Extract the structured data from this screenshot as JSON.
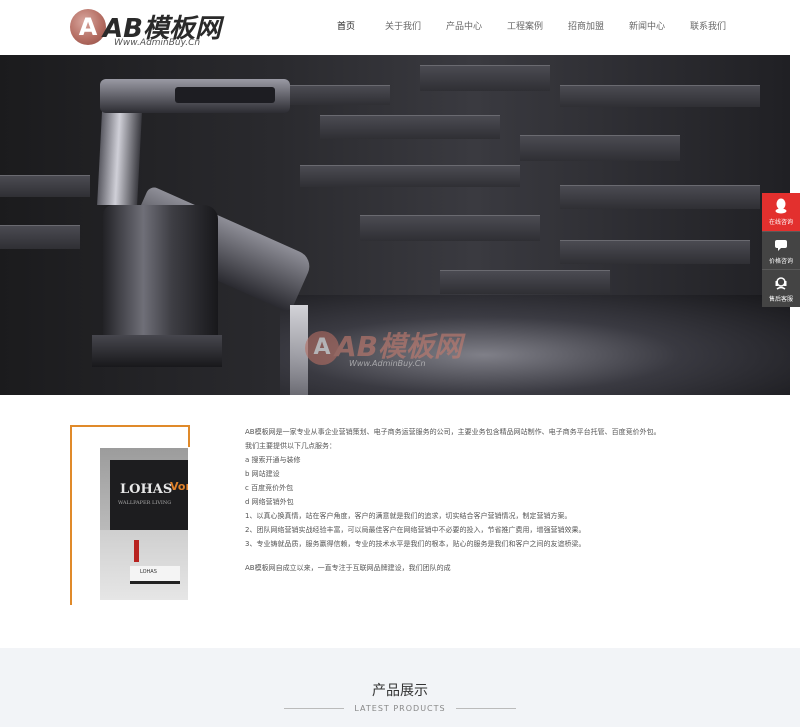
{
  "logo": {
    "mark": "A",
    "name": "AB模板网",
    "subtitle": "Www.AdminBuy.Cn"
  },
  "nav": {
    "items": [
      {
        "label": "首页",
        "active": true
      },
      {
        "label": "关于我们",
        "active": false
      },
      {
        "label": "产品中心",
        "active": false
      },
      {
        "label": "工程案例",
        "active": false
      },
      {
        "label": "招商加盟",
        "active": false
      },
      {
        "label": "新闻中心",
        "active": false
      },
      {
        "label": "联系我们",
        "active": false
      }
    ]
  },
  "banner": {
    "watermark_name": "AB模板网",
    "watermark_sub": "Www.AdminBuy.Cn"
  },
  "float_bar": {
    "items": [
      {
        "label": "在线咨询",
        "icon": "qq-icon"
      },
      {
        "label": "价格咨询",
        "icon": "chat-icon"
      },
      {
        "label": "售后客服",
        "icon": "headset-icon"
      }
    ]
  },
  "about": {
    "image": {
      "brand": "LOHAS",
      "brand_sub": "WALLPAPER LIVING",
      "brand_side": "Vone",
      "counter_text": "LOHAS"
    },
    "lines": [
      "AB模板网是一家专业从事企业营销策划、电子商务运营服务的公司，主要业务包含精品网站制作、电子商务平台托管、百度竞价外包。",
      "我们主要提供以下几点服务：",
      "a  搜索开通与装修",
      "b  网站建设",
      "c  百度竞价外包",
      "d  网络营销外包",
      "1、以真心换真情，站在客户角度，客户的满意就是我们的追求，切实结合客户营销情况，制定营销方案。",
      "2、团队网络营销实战经验丰富，可以局最佳客户在网络营销中不必要的投入，节省推广费用，增强营销效果。",
      "3、专业铸就品质，服务赢得信赖，专业的技术水平是我们的根本，贴心的服务是我们和客户之间的友谊桥梁。"
    ],
    "closing": "AB模板网自成立以来，一直专注于互联网品牌建设，我们团队的成"
  },
  "products": {
    "title": "产品展示",
    "subtitle": "LATEST PRODUCTS"
  }
}
